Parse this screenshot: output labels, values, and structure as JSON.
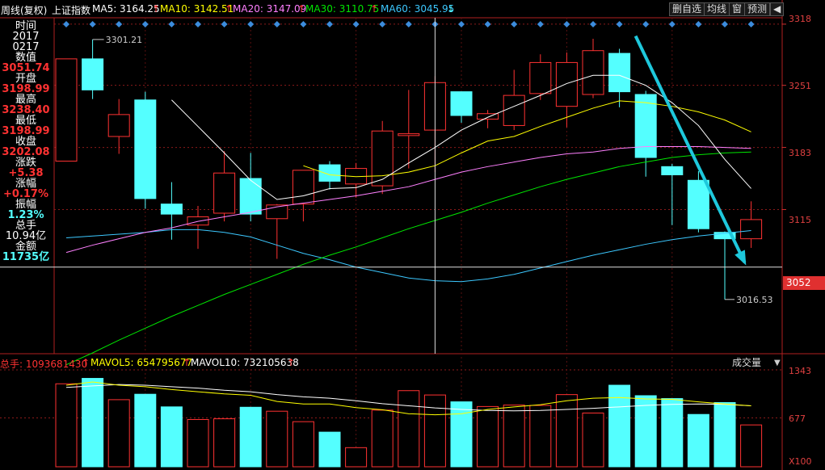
{
  "header": {
    "period_label": "周线(复权)",
    "index_name": "上证指数",
    "ma5": "MA5: 3164.25",
    "ma10": "MA10: 3142.51",
    "ma20": "MA20: 3147.09",
    "ma30": "MA30: 3110.75",
    "ma60": "MA60: 3045.95",
    "arrow_up": "↑",
    "arrow_down": "↓",
    "buttons": [
      "删自选",
      "均线",
      "窗",
      "预测"
    ],
    "back_glyph": "◀",
    "close_glyph": "✕"
  },
  "info_panel": {
    "time_label": "时间",
    "year": "2017",
    "date": "0217",
    "value_label": "数值",
    "value": "3051.74",
    "open_label": "开盘",
    "open": "3198.99",
    "high_label": "最高",
    "high": "3238.40",
    "low_label": "最低",
    "low": "3198.99",
    "close_label": "收盘",
    "close": "3202.08",
    "change_label": "涨跌",
    "change": "+5.38",
    "pct_label": "涨幅",
    "pct": "+0.17%",
    "amp_label": "振幅",
    "amp": "1.23%",
    "vol_label": "总手",
    "vol": "10.94亿",
    "amount_label": "金额",
    "amount": "11735亿"
  },
  "price_axis": {
    "ticks": [
      "3318",
      "3251",
      "3183",
      "3115",
      "3052"
    ],
    "cursor_value": "3052"
  },
  "volume": {
    "total_label": "总手: 1093681430",
    "mavol5": "MAVOL5: 654795677",
    "mavol10": "MAVOL10: 732105638",
    "dropdown": "成交量",
    "ticks": [
      "1343",
      "677",
      "X100"
    ]
  },
  "annotations": {
    "high_mark": "3301.21",
    "low_mark": "3016.53"
  },
  "colors": {
    "up": "#ff3232",
    "down": "#54ffff",
    "ma5": "#ffffff",
    "ma10": "#ffff00",
    "ma20": "#ff80ff",
    "ma30": "#00e600",
    "ma60": "#3cc8ff",
    "arrow": "#1ec8dc"
  },
  "chart_data": {
    "type": "candlestick",
    "candles": [
      {
        "o": 3168,
        "c": 3280,
        "h": 3280,
        "l": 3168,
        "vol": 1150
      },
      {
        "o": 3280,
        "c": 3246,
        "h": 3301.21,
        "l": 3236,
        "vol": 1225
      },
      {
        "o": 3195,
        "c": 3219,
        "h": 3236,
        "l": 3176,
        "vol": 930
      },
      {
        "o": 3235,
        "c": 3127,
        "h": 3244,
        "l": 3116,
        "vol": 1005
      },
      {
        "o": 3121,
        "c": 3110,
        "h": 3145,
        "l": 3082,
        "vol": 830
      },
      {
        "o": 3098,
        "c": 3107,
        "h": 3119,
        "l": 3072,
        "vol": 655
      },
      {
        "o": 3111,
        "c": 3155,
        "h": 3179,
        "l": 3102,
        "vol": 665
      },
      {
        "o": 3149,
        "c": 3110,
        "h": 3177,
        "l": 3102,
        "vol": 825
      },
      {
        "o": 3105,
        "c": 3120,
        "h": 3121,
        "l": 3061,
        "vol": 770
      },
      {
        "o": 3121,
        "c": 3158,
        "h": 3158,
        "l": 3102,
        "vol": 625
      },
      {
        "o": 3164,
        "c": 3146,
        "h": 3168,
        "l": 3137,
        "vol": 480
      },
      {
        "o": 3143,
        "c": 3160,
        "h": 3166,
        "l": 3128,
        "vol": 265
      },
      {
        "o": 3141,
        "c": 3201,
        "h": 3212,
        "l": 3132,
        "vol": 785
      },
      {
        "o": 3196,
        "c": 3198,
        "h": 3246,
        "l": 3160,
        "vol": 1055
      },
      {
        "o": 3202,
        "c": 3254,
        "h": 3261,
        "l": 3156,
        "vol": 995
      },
      {
        "o": 3244,
        "c": 3218,
        "h": 3244,
        "l": 3210,
        "vol": 900
      },
      {
        "o": 3214,
        "c": 3220,
        "h": 3224,
        "l": 3204,
        "vol": 835
      },
      {
        "o": 3207,
        "c": 3240,
        "h": 3268,
        "l": 3202,
        "vol": 855
      },
      {
        "o": 3242,
        "c": 3276,
        "h": 3285,
        "l": 3235,
        "vol": 850
      },
      {
        "o": 3228,
        "c": 3276,
        "h": 3287,
        "l": 3205,
        "vol": 1000
      },
      {
        "o": 3241,
        "c": 3289,
        "h": 3302,
        "l": 3237,
        "vol": 745
      },
      {
        "o": 3286,
        "c": 3244,
        "h": 3291,
        "l": 3227,
        "vol": 1130
      },
      {
        "o": 3241,
        "c": 3172,
        "h": 3245,
        "l": 3151,
        "vol": 985
      },
      {
        "o": 3162,
        "c": 3153,
        "h": 3165,
        "l": 3098,
        "vol": 945
      },
      {
        "o": 3147,
        "c": 3094,
        "h": 3157,
        "l": 3090,
        "vol": 725
      },
      {
        "o": 3090,
        "c": 3083,
        "h": 3091,
        "l": 3016.53,
        "vol": 890
      },
      {
        "o": 3083,
        "c": 3104,
        "h": 3124,
        "l": 3073,
        "vol": 580
      }
    ],
    "ma5": [
      null,
      null,
      null,
      null,
      3235,
      3206,
      3177,
      3147,
      3126,
      3130,
      3138,
      3139,
      3148,
      3166,
      3183,
      3202,
      3216,
      3228,
      3240,
      3253,
      3262,
      3262,
      3251,
      3232,
      3207,
      3170,
      3138
    ],
    "ma10": [
      null,
      null,
      null,
      null,
      null,
      null,
      null,
      null,
      null,
      3163,
      3153,
      3151,
      3152,
      3156,
      3163,
      3177,
      3190,
      3195,
      3206,
      3216,
      3226,
      3234,
      3232,
      3228,
      3222,
      3213,
      3200
    ],
    "ma20": [
      3068,
      3076,
      3083,
      3090,
      3095,
      3102,
      3107,
      3112,
      3118,
      3122,
      3126,
      3130,
      3135,
      3140,
      3148,
      3156,
      3162,
      3167,
      3172,
      3176,
      3178,
      3182,
      3184,
      3184,
      3184,
      3183,
      3182
    ],
    "ma30": [
      2945,
      2958,
      2972,
      2985,
      2998,
      3010,
      3022,
      3033,
      3044,
      3055,
      3065,
      3074,
      3084,
      3094,
      3103,
      3112,
      3122,
      3131,
      3140,
      3148,
      3155,
      3162,
      3167,
      3172,
      3175,
      3177,
      3178
    ],
    "ma60": [
      3084,
      3086,
      3088,
      3090,
      3093,
      3093,
      3090,
      3085,
      3076,
      3067,
      3060,
      3052,
      3046,
      3040,
      3037,
      3036,
      3039,
      3044,
      3051,
      3058,
      3065,
      3071,
      3077,
      3082,
      3086,
      3089,
      3092
    ],
    "mavol5": [
      1130,
      1175,
      1130,
      1110,
      1070,
      1040,
      1010,
      990,
      905,
      870,
      870,
      820,
      790,
      735,
      720,
      735,
      795,
      830,
      860,
      915,
      950,
      960,
      940,
      935,
      900,
      870,
      845
    ],
    "mavol10": [
      1100,
      1120,
      1140,
      1130,
      1110,
      1090,
      1060,
      1040,
      1000,
      970,
      950,
      915,
      875,
      845,
      815,
      795,
      780,
      775,
      780,
      795,
      810,
      830,
      850,
      865,
      870,
      865,
      845
    ],
    "price_range": [
      2958,
      3325
    ],
    "volume_range": [
      0,
      1343
    ],
    "cursor_index": 14,
    "cursor_price": 3052
  }
}
